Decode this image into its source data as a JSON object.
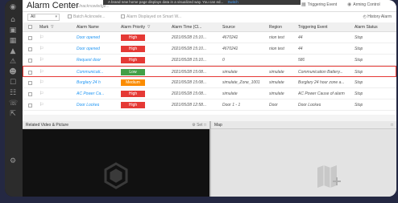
{
  "app": {
    "title": "Alarm Center",
    "unacknowledged_label": "Unacknowledge...",
    "banner_text": "A brand new home page displays data in a visualized way. You can ed...",
    "banner_link": "Switch",
    "triggering_event_label": "Triggering Event",
    "arming_control_label": "Arming Control"
  },
  "toolbar": {
    "filter_value": "All",
    "batch_ack_label": "Batch Acknowle...",
    "alarm_smart_wall_label": "Alarm Displayed on Smart W...",
    "history_label": "History Alarm"
  },
  "table": {
    "columns": [
      "Mark",
      "Alarm Name",
      "Alarm Priority",
      "Alarm Time (Cl...",
      "Source",
      "Region",
      "Triggering Event",
      "Alarm Status"
    ],
    "rows": [
      {
        "name": "Door opened",
        "priority": "High",
        "priority_color": "#e53935",
        "time": "2021/05/28 15:10...",
        "source": "4670242",
        "region": "nion test",
        "event": "44",
        "status": "Stop",
        "selected": false
      },
      {
        "name": "Door opened",
        "priority": "High",
        "priority_color": "#e53935",
        "time": "2021/05/28 15:10...",
        "source": "4670242",
        "region": "nion test",
        "event": "44",
        "status": "Stop",
        "selected": false
      },
      {
        "name": "Request door",
        "priority": "High",
        "priority_color": "#e53935",
        "time": "2021/05/28 15:10...",
        "source": "0",
        "region": "",
        "event": "580",
        "status": "Stop",
        "selected": false
      },
      {
        "name": "Communicati...",
        "priority": "Low",
        "priority_color": "#43a047",
        "time": "2021/05/28 15:08...",
        "source": "simulate",
        "region": "simulate",
        "event": "Communication Battery...",
        "status": "Stop",
        "selected": true
      },
      {
        "name": "Burglary 24 h",
        "priority": "Medium",
        "priority_color": "#fb8c00",
        "time": "2021/05/28 15:08...",
        "source": "simulate_Zone_1001",
        "region": "simulate",
        "event": "Burglary 24 hour zone a...",
        "status": "Stop",
        "selected": false
      },
      {
        "name": "AC Power Ca...",
        "priority": "High",
        "priority_color": "#e53935",
        "time": "2021/05/28 15:08...",
        "source": "simulate",
        "region": "simulate",
        "event": "AC Power Cause of alarm",
        "status": "Stop",
        "selected": false
      },
      {
        "name": "Door Locked",
        "priority": "High",
        "priority_color": "#e53935",
        "time": "2021/05/28 12:58...",
        "source": "Door 1 - 1",
        "region": "Door",
        "event": "Door Locked",
        "status": "Stop",
        "selected": false
      }
    ]
  },
  "panels": {
    "video_title": "Related Video & Picture",
    "video_set_label": "Set",
    "map_title": "Map"
  },
  "colors": {
    "accent": "#2196f3",
    "selection": "#e53935"
  }
}
